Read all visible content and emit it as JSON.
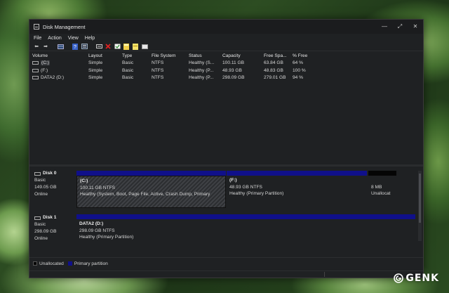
{
  "window": {
    "title": "Disk Management",
    "controls": {
      "minimize": "—",
      "maximize": "⤢",
      "close": "✕"
    }
  },
  "menu": [
    "File",
    "Action",
    "View",
    "Help"
  ],
  "toolbar": [
    "back-icon",
    "forward-icon",
    "list-view-icon",
    "help-icon",
    "properties-icon",
    "rescan-icon",
    "delete-icon",
    "check-icon",
    "folder-icon",
    "folder-open-icon",
    "disk-icon"
  ],
  "volumes": {
    "headers": [
      "Volume",
      "Layout",
      "Type",
      "File System",
      "Status",
      "Capacity",
      "Free Spa...",
      "% Free"
    ],
    "rows": [
      [
        "(C:)",
        "Simple",
        "Basic",
        "NTFS",
        "Healthy (S...",
        "100.11 GB",
        "63.84 GB",
        "64 %"
      ],
      [
        "(F:)",
        "Simple",
        "Basic",
        "NTFS",
        "Healthy (P...",
        "48.93 GB",
        "48.83 GB",
        "100 %"
      ],
      [
        "DATA2 (D:)",
        "Simple",
        "Basic",
        "NTFS",
        "Healthy (P...",
        "298.09 GB",
        "279.01 GB",
        "94 %"
      ]
    ]
  },
  "disks": [
    {
      "name": "Disk 0",
      "type": "Basic",
      "size": "149.05 GB",
      "state": "Online",
      "partitions": [
        {
          "name": "(C:)",
          "size": "100.11 GB NTFS",
          "status": "Healthy (System, Boot, Page File, Active, Crash Dump, Primary"
        },
        {
          "name": "(F:)",
          "size": "48.93 GB NTFS",
          "status": "Healthy (Primary Partition)"
        },
        {
          "name": "",
          "size": "8 MB",
          "status": "Unallocat"
        }
      ]
    },
    {
      "name": "Disk 1",
      "type": "Basic",
      "size": "298.09 GB",
      "state": "Online",
      "partitions": [
        {
          "name": "DATA2 (D:)",
          "size": "298.09 GB NTFS",
          "status": "Healthy (Primary Partition)"
        }
      ]
    }
  ],
  "legend": [
    {
      "label": "Unallocated",
      "color": "#050505"
    },
    {
      "label": "Primary partition",
      "color": "#10108a"
    }
  ],
  "colors": {
    "primary": "#10108a",
    "unallocated": "#050505",
    "window_bg": "#1f2123"
  },
  "watermark": {
    "text": "GENK"
  }
}
